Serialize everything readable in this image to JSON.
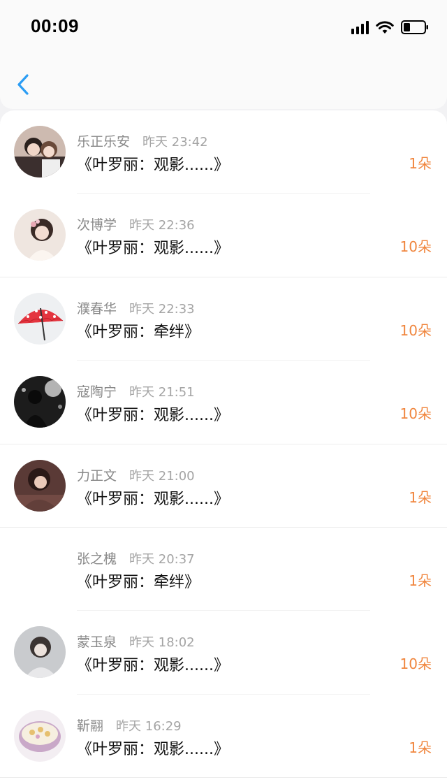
{
  "status_bar": {
    "time": "00:09"
  },
  "nav": {
    "back_icon": "chevron-left-icon",
    "accent": "#2b9df4"
  },
  "colors": {
    "count": "#f0863e",
    "name": "#888888",
    "title": "#111111"
  },
  "records": [
    {
      "name": "乐正乐安",
      "stamp": "昨天 23:42",
      "title": "《叶罗丽：观影......》",
      "count": "1朵"
    },
    {
      "name": "次博学",
      "stamp": "昨天 22:36",
      "title": "《叶罗丽：观影......》",
      "count": "10朵"
    },
    {
      "name": "濮春华",
      "stamp": "昨天 22:33",
      "title": "《叶罗丽：牵绊》",
      "count": "10朵"
    },
    {
      "name": "寇陶宁",
      "stamp": "昨天 21:51",
      "title": "《叶罗丽：观影......》",
      "count": "10朵"
    },
    {
      "name": "力正文",
      "stamp": "昨天 21:00",
      "title": "《叶罗丽：观影......》",
      "count": "1朵"
    },
    {
      "name": "张之槐",
      "stamp": "昨天 20:37",
      "title": "《叶罗丽：牵绊》",
      "count": "1朵"
    },
    {
      "name": "蒙玉泉",
      "stamp": "昨天 18:02",
      "title": "《叶罗丽：观影......》",
      "count": "10朵"
    },
    {
      "name": "靳翮",
      "stamp": "昨天 16:29",
      "title": "《叶罗丽：观影......》",
      "count": "1朵"
    }
  ]
}
